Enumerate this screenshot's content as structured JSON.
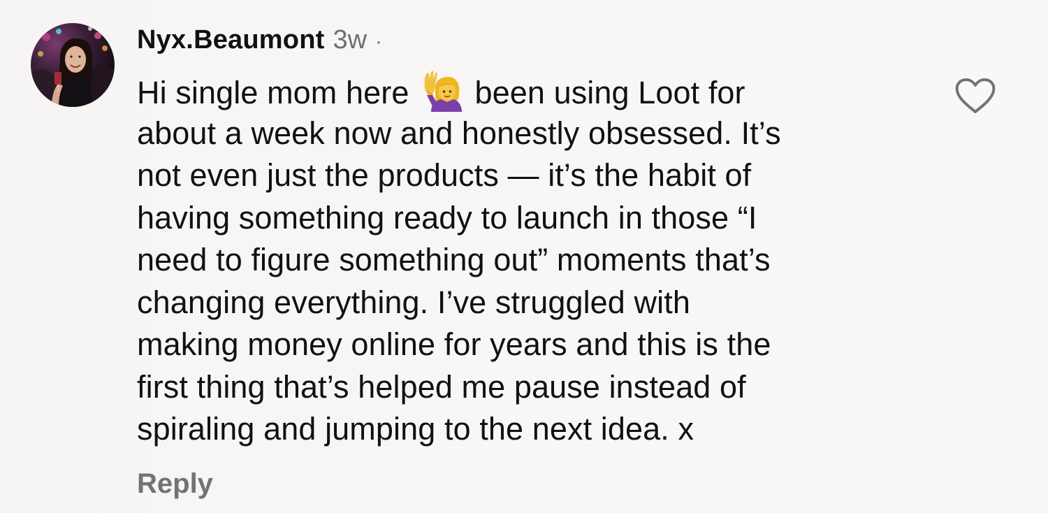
{
  "comment": {
    "username": "Nyx.Beaumont",
    "time": "3w",
    "separator": "·",
    "lines": [
      "Hi single mom here",
      "been using Loot for",
      "about a week now and honestly obsessed. It’s",
      "not even just the products — it’s the habit of",
      "having something ready to launch in those “I",
      "need to figure something out” moments that’s",
      "changing everything. I’ve struggled with",
      "making money online for years and this is the",
      "first thing that’s helped me pause instead of",
      "spiraling and jumping to the next idea. x"
    ],
    "emoji": "person-raising-hand-icon",
    "reply_label": "Reply"
  },
  "colors": {
    "text": "#111111",
    "secondary": "#6f6f6f",
    "reply": "#737373",
    "background": "#f7f6f5"
  }
}
